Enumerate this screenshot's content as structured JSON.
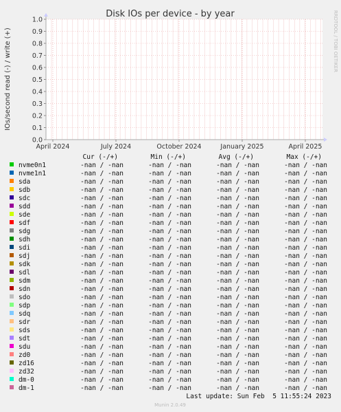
{
  "chart_data": {
    "type": "line",
    "title": "Disk IOs per device - by year",
    "ylabel": "IOs/second read (-) / write (+)",
    "side_text": "RRDTOOL / TOBI OETIKER",
    "ylim": [
      0,
      1.0
    ],
    "y_ticks": [
      "0.0",
      "0.1",
      "0.2",
      "0.3",
      "0.4",
      "0.5",
      "0.6",
      "0.7",
      "0.8",
      "0.9",
      "1.0"
    ],
    "x_ticks": [
      "April 2024",
      "July 2024",
      "October 2024",
      "January 2025",
      "April 2025"
    ],
    "grid": true,
    "legend_headers": [
      "Cur (-/+)",
      "Min (-/+)",
      "Avg (-/+)",
      "Max (-/+)"
    ],
    "series": [
      {
        "name": "nvme0n1",
        "color": "#00cc00",
        "cur": "-nan /  -nan",
        "min": "-nan /  -nan",
        "avg": "-nan /  -nan",
        "max": "-nan /  -nan"
      },
      {
        "name": "nvme1n1",
        "color": "#0066b3",
        "cur": "-nan /  -nan",
        "min": "-nan /  -nan",
        "avg": "-nan /  -nan",
        "max": "-nan /  -nan"
      },
      {
        "name": "sda",
        "color": "#ff8000",
        "cur": "-nan /  -nan",
        "min": "-nan /  -nan",
        "avg": "-nan /  -nan",
        "max": "-nan /  -nan"
      },
      {
        "name": "sdb",
        "color": "#ffcc00",
        "cur": "-nan /  -nan",
        "min": "-nan /  -nan",
        "avg": "-nan /  -nan",
        "max": "-nan /  -nan"
      },
      {
        "name": "sdc",
        "color": "#330099",
        "cur": "-nan /  -nan",
        "min": "-nan /  -nan",
        "avg": "-nan /  -nan",
        "max": "-nan /  -nan"
      },
      {
        "name": "sdd",
        "color": "#990099",
        "cur": "-nan /  -nan",
        "min": "-nan /  -nan",
        "avg": "-nan /  -nan",
        "max": "-nan /  -nan"
      },
      {
        "name": "sde",
        "color": "#ccff00",
        "cur": "-nan /  -nan",
        "min": "-nan /  -nan",
        "avg": "-nan /  -nan",
        "max": "-nan /  -nan"
      },
      {
        "name": "sdf",
        "color": "#ff0000",
        "cur": "-nan /  -nan",
        "min": "-nan /  -nan",
        "avg": "-nan /  -nan",
        "max": "-nan /  -nan"
      },
      {
        "name": "sdg",
        "color": "#808080",
        "cur": "-nan /  -nan",
        "min": "-nan /  -nan",
        "avg": "-nan /  -nan",
        "max": "-nan /  -nan"
      },
      {
        "name": "sdh",
        "color": "#008f00",
        "cur": "-nan /  -nan",
        "min": "-nan /  -nan",
        "avg": "-nan /  -nan",
        "max": "-nan /  -nan"
      },
      {
        "name": "sdi",
        "color": "#00487d",
        "cur": "-nan /  -nan",
        "min": "-nan /  -nan",
        "avg": "-nan /  -nan",
        "max": "-nan /  -nan"
      },
      {
        "name": "sdj",
        "color": "#b35a00",
        "cur": "-nan /  -nan",
        "min": "-nan /  -nan",
        "avg": "-nan /  -nan",
        "max": "-nan /  -nan"
      },
      {
        "name": "sdk",
        "color": "#b38f00",
        "cur": "-nan /  -nan",
        "min": "-nan /  -nan",
        "avg": "-nan /  -nan",
        "max": "-nan /  -nan"
      },
      {
        "name": "sdl",
        "color": "#6b006b",
        "cur": "-nan /  -nan",
        "min": "-nan /  -nan",
        "avg": "-nan /  -nan",
        "max": "-nan /  -nan"
      },
      {
        "name": "sdm",
        "color": "#8fb300",
        "cur": "-nan /  -nan",
        "min": "-nan /  -nan",
        "avg": "-nan /  -nan",
        "max": "-nan /  -nan"
      },
      {
        "name": "sdn",
        "color": "#b30000",
        "cur": "-nan /  -nan",
        "min": "-nan /  -nan",
        "avg": "-nan /  -nan",
        "max": "-nan /  -nan"
      },
      {
        "name": "sdo",
        "color": "#bebebe",
        "cur": "-nan /  -nan",
        "min": "-nan /  -nan",
        "avg": "-nan /  -nan",
        "max": "-nan /  -nan"
      },
      {
        "name": "sdp",
        "color": "#80ff80",
        "cur": "-nan /  -nan",
        "min": "-nan /  -nan",
        "avg": "-nan /  -nan",
        "max": "-nan /  -nan"
      },
      {
        "name": "sdq",
        "color": "#80c9ff",
        "cur": "-nan /  -nan",
        "min": "-nan /  -nan",
        "avg": "-nan /  -nan",
        "max": "-nan /  -nan"
      },
      {
        "name": "sdr",
        "color": "#ffc080",
        "cur": "-nan /  -nan",
        "min": "-nan /  -nan",
        "avg": "-nan /  -nan",
        "max": "-nan /  -nan"
      },
      {
        "name": "sds",
        "color": "#ffe680",
        "cur": "-nan /  -nan",
        "min": "-nan /  -nan",
        "avg": "-nan /  -nan",
        "max": "-nan /  -nan"
      },
      {
        "name": "sdt",
        "color": "#aa80ff",
        "cur": "-nan /  -nan",
        "min": "-nan /  -nan",
        "avg": "-nan /  -nan",
        "max": "-nan /  -nan"
      },
      {
        "name": "sdu",
        "color": "#ee00cc",
        "cur": "-nan /  -nan",
        "min": "-nan /  -nan",
        "avg": "-nan /  -nan",
        "max": "-nan /  -nan"
      },
      {
        "name": "zd0",
        "color": "#ff8080",
        "cur": "-nan /  -nan",
        "min": "-nan /  -nan",
        "avg": "-nan /  -nan",
        "max": "-nan /  -nan"
      },
      {
        "name": "zd16",
        "color": "#666600",
        "cur": "-nan /  -nan",
        "min": "-nan /  -nan",
        "avg": "-nan /  -nan",
        "max": "-nan /  -nan"
      },
      {
        "name": "zd32",
        "color": "#ffbfff",
        "cur": "-nan /  -nan",
        "min": "-nan /  -nan",
        "avg": "-nan /  -nan",
        "max": "-nan /  -nan"
      },
      {
        "name": "dm-0",
        "color": "#00ffcc",
        "cur": "-nan /  -nan",
        "min": "-nan /  -nan",
        "avg": "-nan /  -nan",
        "max": "-nan /  -nan"
      },
      {
        "name": "dm-1",
        "color": "#cc6699",
        "cur": "-nan /  -nan",
        "min": "-nan /  -nan",
        "avg": "-nan /  -nan",
        "max": "-nan /  -nan"
      }
    ],
    "last_update": "Last update: Sun Feb  5 11:55:24 2023",
    "footer": "Munin 2.0.49"
  }
}
